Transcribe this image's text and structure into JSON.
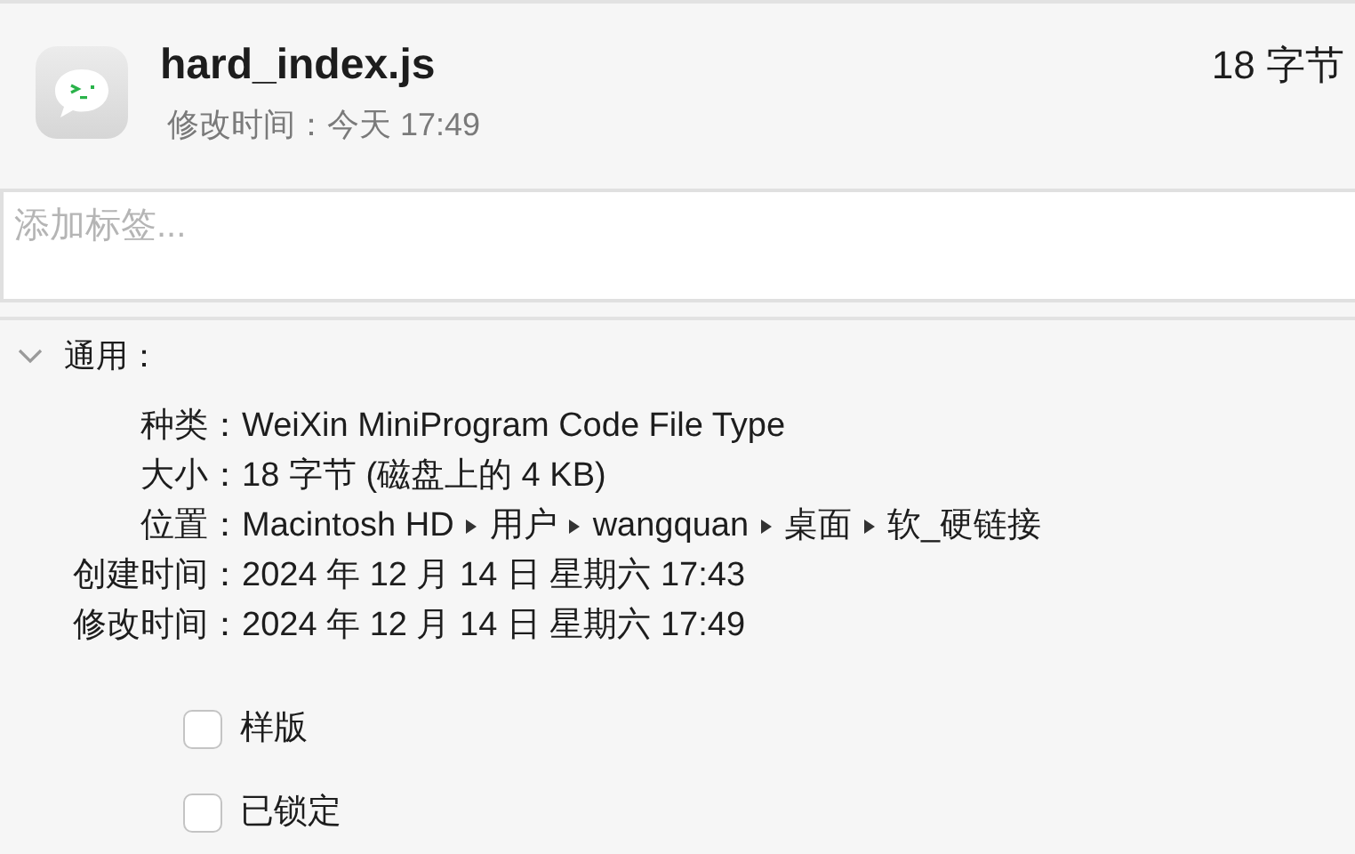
{
  "file": {
    "name": "hard_index.js",
    "size": "18 字节",
    "modified": "修改时间：今天 17:49"
  },
  "tags": {
    "placeholder": "添加标签..."
  },
  "general": {
    "title": "通用：",
    "expanded": true,
    "rows": [
      {
        "kind": "text",
        "label": "种类：",
        "value": "WeiXin MiniProgram Code File Type"
      },
      {
        "kind": "text",
        "label": "大小：",
        "value": "18 字节 (磁盘上的 4 KB)"
      },
      {
        "kind": "path",
        "label": "位置：",
        "segments": [
          "Macintosh HD",
          "用户",
          "wangquan",
          "桌面",
          "软_硬链接"
        ]
      },
      {
        "kind": "text",
        "label": "创建时间：",
        "value": "2024 年 12 月 14 日 星期六 17:43"
      },
      {
        "kind": "text",
        "label": "修改时间：",
        "value": "2024 年 12 月 14 日 星期六 17:49"
      }
    ],
    "options": [
      {
        "label": "样版",
        "checked": false
      },
      {
        "label": "已锁定",
        "checked": false
      }
    ]
  }
}
